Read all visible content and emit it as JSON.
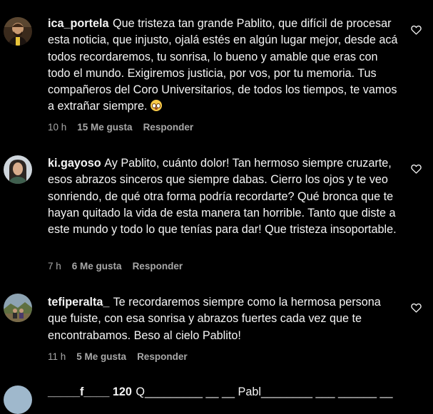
{
  "comments": [
    {
      "username": "ica_portela",
      "text": "Que tristeza tan grande Pablito, que difícil de procesar esta noticia, que injusto, ojalá estés en algún lugar mejor, desde acá todos recordaremos, tu sonrisa, lo bueno y amable que eras con todo el mundo. Exigiremos justicia, por vos, por tu memoria. Tus compañeros del Coro Universitarios, de todos los tiempos, te vamos a extrañar siempre.",
      "emoji": "face-with-pleading-eyes",
      "time": "10 h",
      "likes": "15 Me gusta",
      "reply": "Responder"
    },
    {
      "username": "ki.gayoso",
      "text": "Ay Pablito, cuánto dolor! Tan hermoso siempre cruzarte, esos abrazos sinceros que siempre dabas. Cierro los ojos y te veo sonriendo, de qué otra forma podría recordarte? Qué bronca que te hayan quitado la vida de esta manera tan horrible. Tanto que diste a este mundo y todo lo que tenías para dar! Que tristeza insoportable.",
      "time": "7 h",
      "likes": "6 Me gusta",
      "reply": "Responder"
    },
    {
      "username": "tefiperalta_",
      "text": "Te recordaremos siempre como la hermosa persona que fuiste, con esa sonrisa y abrazos fuertes cada vez que te encontrabamos. Beso al cielo Pablito!",
      "time": "11 h",
      "likes": "5 Me gusta",
      "reply": "Responder"
    }
  ],
  "partial_comment": {
    "username": "_____f____ 120",
    "text": "Q_________ __ __ Pabl________ ___ ______ __"
  },
  "colors": {
    "background": "#000000",
    "text": "#f5f5f5",
    "meta": "#a8a8a8"
  },
  "icons": {
    "like": "heart-outline-icon"
  }
}
